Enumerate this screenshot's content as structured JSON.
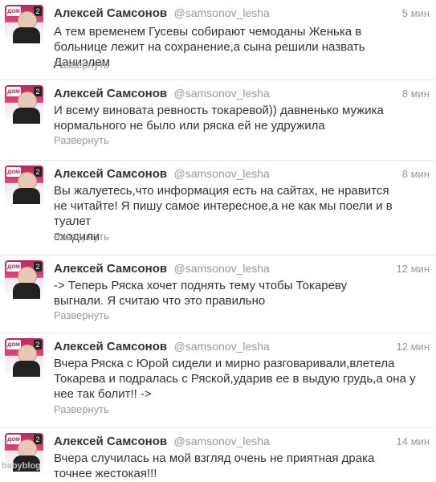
{
  "tweets": [
    {
      "name": "Алексей Самсонов",
      "handle": "@samsonov_lesha",
      "time": "5 мин",
      "lines": [
        "А тем временем Гусевы собирают чемоданы Женька в",
        "больнице лежит на сохранение,а сына решили назвать Даниэлем"
      ],
      "expand": "Развернуть"
    },
    {
      "name": "Алексей Самсонов",
      "handle": "@samsonov_lesha",
      "time": "8 мин",
      "lines": [
        "И всему виновата ревность токаревой)) давненько мужика",
        "нормального не было или ряска ей не удружила"
      ],
      "expand": "Развернуть"
    },
    {
      "name": "Алексей Самсонов",
      "handle": "@samsonov_lesha",
      "time": "8 мин",
      "lines": [
        "Вы жалуетесь,что информация есть на сайтах, не нравится",
        "не читайте! Я пишу самое интересное,а не как мы поели и в туалет",
        "сходили"
      ],
      "expand": "Развернуть"
    },
    {
      "name": "Алексей Самсонов",
      "handle": "@samsonov_lesha",
      "time": "12 мин",
      "lines": [
        "-> Теперь Ряска хочет поднять тему чтобы Токареву",
        "выгнали. Я считаю что это правильно"
      ],
      "expand": "Развернуть"
    },
    {
      "name": "Алексей Самсонов",
      "handle": "@samsonov_lesha",
      "time": "12 мин",
      "lines": [
        "Вчера Ряска с Юрой сидели и мирно разговаривали,влетела",
        "Токарева и подралась с Ряской,ударив ее в выдую грудь,а она у",
        "нее так болит!! ->"
      ],
      "expand": "Развернуть"
    },
    {
      "name": "Алексей Самсонов",
      "handle": "@samsonov_lesha",
      "time": "14 мин",
      "lines": [
        "Вчера случилась на мой взгляд очень не приятная драка",
        "точнее жестокая!!!"
      ],
      "expand": ""
    }
  ],
  "avatar_logo": "дом",
  "avatar_num": "2",
  "watermark": "babyblog"
}
